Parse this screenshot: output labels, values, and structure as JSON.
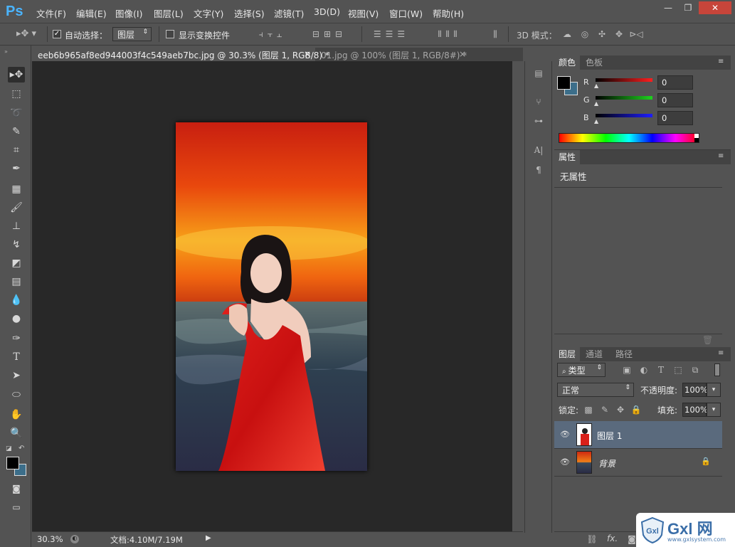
{
  "app": {
    "logo": "Ps"
  },
  "menus": [
    "文件(F)",
    "编辑(E)",
    "图像(I)",
    "图层(L)",
    "文字(Y)",
    "选择(S)",
    "滤镜(T)",
    "3D(D)",
    "视图(V)",
    "窗口(W)",
    "帮助(H)"
  ],
  "window_controls": {
    "minimize": "—",
    "restore": "❐",
    "close": "✕"
  },
  "options": {
    "auto_select_label": "自动选择：",
    "auto_select_value": "图层",
    "show_transform_label": "显示变换控件",
    "mode_3d_label": "3D 模式："
  },
  "tabs": [
    {
      "label": "eeb6b965af8ed944003f4c549aeb7bc.jpg @ 30.3% (图层 1, RGB/8) *",
      "close": "×"
    },
    {
      "label": "01.jpg @ 100% (图层 1, RGB/8#) *",
      "close": "×"
    }
  ],
  "status": {
    "zoom": "30.3%",
    "doc": "文档:4.10M/7.19M"
  },
  "color_panel": {
    "tabs": [
      "颜色",
      "色板"
    ],
    "channels": [
      {
        "label": "R",
        "value": "0",
        "color": "#ff1e1e"
      },
      {
        "label": "G",
        "value": "0",
        "color": "#1ed21e"
      },
      {
        "label": "B",
        "value": "0",
        "color": "#1e1eff"
      }
    ]
  },
  "properties_panel": {
    "tab": "属性",
    "empty_text": "无属性"
  },
  "layers_panel": {
    "tabs": [
      "图层",
      "通道",
      "路径"
    ],
    "filter_label": "类型",
    "blend_mode": "正常",
    "opacity_label": "不透明度:",
    "opacity_value": "100%",
    "lock_label": "锁定:",
    "fill_label": "填充:",
    "fill_value": "100%",
    "layers": [
      {
        "name": "图层 1",
        "selected": true
      },
      {
        "name": "背景",
        "locked": true
      }
    ],
    "footer_fx": "fx."
  },
  "watermark": {
    "brand": "Gxl 网",
    "url": "www.gxlsystem.com"
  }
}
